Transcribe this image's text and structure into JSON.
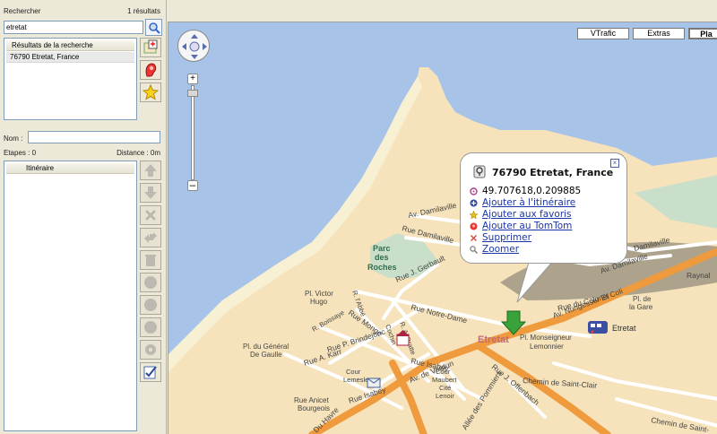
{
  "search": {
    "label": "Rechercher",
    "count": "1 résultats",
    "input_value": "etretat",
    "results_header": "Résultats de la recherche",
    "results": [
      "76790 Etretat, France"
    ]
  },
  "route": {
    "name_label": "Nom :",
    "name_value": "",
    "steps_label": "Etapes : 0",
    "distance_label": "Distance : 0m",
    "itinerary_header": "Itinéraire"
  },
  "map_tabs": [
    "VTrafic",
    "Extras",
    "Pla"
  ],
  "popup": {
    "title": "76790 Etretat, France",
    "coords": "49.707618,0.209885",
    "actions": [
      "Ajouter à l'itinéraire",
      "Ajouter aux favoris",
      "Ajouter au TomTom",
      "Supprimer",
      "Zoomer"
    ]
  },
  "map_labels": {
    "parc": "Parc",
    "des": "des",
    "roches": "Roches",
    "town": "Etretat",
    "etretat_poi": "Etretat",
    "verdun": "Av. de Verdun",
    "nungesser": "Av. Nungesser Et Coli",
    "damilaville1": "Av. Damilaville",
    "damilaville2": "Rue Damilaville",
    "damilaville3": "Damilaville",
    "damilaville4": "Av. Damilaville",
    "gerbault": "Rue J. Gerbault",
    "notre_dame": "Rue Notre-Dame",
    "colonel": "Rue du Colonel",
    "raynal": "Raynal",
    "gare1": "Pl. de",
    "gare2": "la Gare",
    "monseigneur1": "Pl. Monseigneur",
    "monseigneur2": "Lemonnier",
    "victor1": "Pl. Victor",
    "victor2": "Hugo",
    "general1": "Pl. du Général",
    "general2": "De Gaulle",
    "monge": "Rue Monge",
    "brindejonc": "Rue P. Brindejonc",
    "karr": "Rue A. Karr",
    "isabey": "Rue Isabey",
    "isabey2": "Rue Isabey",
    "cour_lemesle1": "Cour",
    "cour_lemesle2": "Lemesle",
    "cour_maubert1": "Cour",
    "cour_maubert2": "Maubert",
    "cite1": "Cité",
    "cite2": "Lenoir",
    "aniscet1": "Rue Anicet",
    "aniscet2": "Bourgeois",
    "saint_clair": "Chemin de Saint-Clair",
    "saint_clair2": "Chemin de Saint-",
    "offenbach": "Rue J. Offenbach",
    "havre": "Du Havre",
    "allee": "Allée des Pommiers",
    "boissaye": "R. Boissaye",
    "abbe": "R. l'Abbé",
    "cochin": "Cochin",
    "anatole": "R. A. Bratte"
  },
  "colors": {
    "sea": "#a8c3e8",
    "land": "#f6e3bb",
    "park": "#c9dfc9",
    "road_major": "#ef9a3c",
    "road_minor": "#ffffff",
    "link": "#1a35a8"
  }
}
